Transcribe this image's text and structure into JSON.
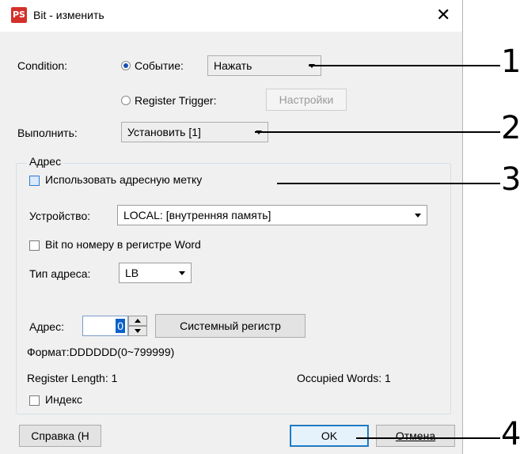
{
  "window": {
    "title": "Bit - изменить",
    "app_icon": "PS",
    "close_glyph": "✕"
  },
  "condition": {
    "label": "Condition:",
    "radio_event": "Событие:",
    "event_value": "Нажать",
    "radio_register": "Register Trigger:",
    "settings_button": "Настройки"
  },
  "execute": {
    "label": "Выполнить:",
    "value": "Установить [1]"
  },
  "address_group": {
    "title": "Адрес",
    "use_tag": "Использовать адресную метку",
    "device_label": "Устройство:",
    "device_value": "LOCAL: [внутренняя память]",
    "bit_by_word": "Bit по номеру в регистре Word",
    "addr_type_label": "Тип адреса:",
    "addr_type_value": "LB",
    "address_label": "Адрес:",
    "address_value": "0",
    "system_register_button": "Системный регистр",
    "format": "Формат:DDDDDD(0~799999)",
    "register_length": "Register Length: 1",
    "occupied_words": "Occupied Words: 1",
    "index": "Индекс"
  },
  "footer": {
    "help_button": "Справка (Н",
    "ok_button": "OK",
    "cancel_button": "Отмена"
  },
  "callouts": [
    "1",
    "2",
    "3",
    "4"
  ]
}
